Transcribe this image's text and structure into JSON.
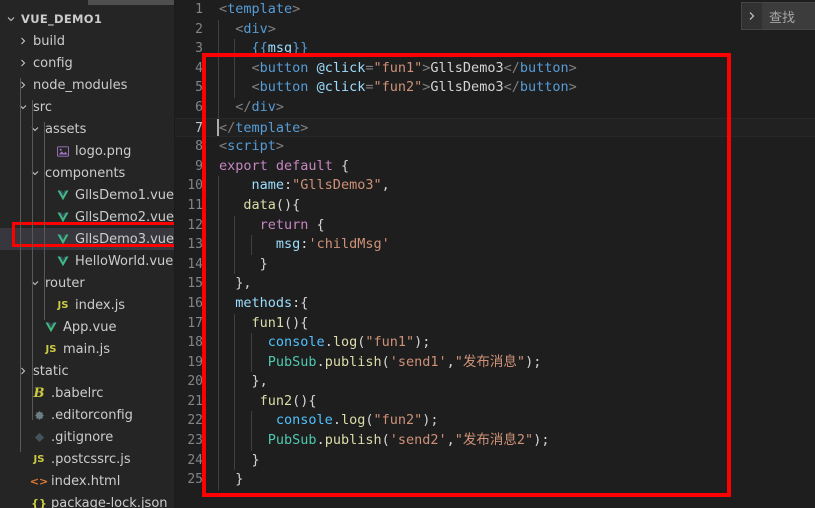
{
  "window": {
    "theme_bg": "#1e1e1e",
    "sidebar_bg": "#252526",
    "accent_red": "#ff0000"
  },
  "sidebar": {
    "root_label": "VUE_DEMO1",
    "items": [
      {
        "label": "build",
        "indent": 1,
        "type": "folder",
        "expanded": false
      },
      {
        "label": "config",
        "indent": 1,
        "type": "folder",
        "expanded": false
      },
      {
        "label": "node_modules",
        "indent": 1,
        "type": "folder",
        "expanded": false
      },
      {
        "label": "src",
        "indent": 1,
        "type": "folder",
        "expanded": true
      },
      {
        "label": "assets",
        "indent": 2,
        "type": "folder",
        "expanded": true
      },
      {
        "label": "logo.png",
        "indent": 3,
        "type": "image"
      },
      {
        "label": "components",
        "indent": 2,
        "type": "folder",
        "expanded": true
      },
      {
        "label": "GllsDemo1.vue",
        "indent": 3,
        "type": "vue"
      },
      {
        "label": "GllsDemo2.vue",
        "indent": 3,
        "type": "vue"
      },
      {
        "label": "GllsDemo3.vue",
        "indent": 3,
        "type": "vue",
        "selected": true,
        "highlighted": true
      },
      {
        "label": "HelloWorld.vue",
        "indent": 3,
        "type": "vue"
      },
      {
        "label": "router",
        "indent": 2,
        "type": "folder",
        "expanded": true
      },
      {
        "label": "index.js",
        "indent": 3,
        "type": "js"
      },
      {
        "label": "App.vue",
        "indent": 2,
        "type": "vue"
      },
      {
        "label": "main.js",
        "indent": 2,
        "type": "js"
      },
      {
        "label": "static",
        "indent": 1,
        "type": "folder",
        "expanded": false
      },
      {
        "label": ".babelrc",
        "indent": 1,
        "type": "babel"
      },
      {
        "label": ".editorconfig",
        "indent": 1,
        "type": "gear"
      },
      {
        "label": ".gitignore",
        "indent": 1,
        "type": "git"
      },
      {
        "label": ".postcssrc.js",
        "indent": 1,
        "type": "js"
      },
      {
        "label": "index.html",
        "indent": 1,
        "type": "html"
      },
      {
        "label": "package-lock.json",
        "indent": 1,
        "type": "json"
      }
    ]
  },
  "find_widget": {
    "toggle_icon": "chevron-right-icon",
    "placeholder": "查找",
    "value": ""
  },
  "editor": {
    "active_line": 7,
    "first_line": 1,
    "last_line": 25,
    "lines": [
      {
        "n": 1,
        "tokens": [
          [
            "t-brk",
            "<"
          ],
          [
            "t-tag",
            "template"
          ],
          [
            "t-brk",
            ">"
          ]
        ],
        "indent": 0
      },
      {
        "n": 2,
        "tokens": [
          [
            "t-txt",
            "  "
          ],
          [
            "t-brk",
            "<"
          ],
          [
            "t-tag",
            "div"
          ],
          [
            "t-brk",
            ">"
          ]
        ],
        "indent": 1
      },
      {
        "n": 3,
        "tokens": [
          [
            "t-txt",
            "    "
          ],
          [
            "t-mustache",
            "{{"
          ],
          [
            "t-attr",
            "msg"
          ],
          [
            "t-mustache",
            "}}"
          ]
        ],
        "indent": 2
      },
      {
        "n": 4,
        "tokens": [
          [
            "t-txt",
            "    "
          ],
          [
            "t-brk",
            "<"
          ],
          [
            "t-tag",
            "button"
          ],
          [
            "t-txt",
            " "
          ],
          [
            "t-attr",
            "@click"
          ],
          [
            "t-brk",
            "="
          ],
          [
            "t-str",
            "\"fun1\""
          ],
          [
            "t-brk",
            ">"
          ],
          [
            "t-txt",
            "GllsDemo3"
          ],
          [
            "t-brk",
            "</"
          ],
          [
            "t-tag",
            "button"
          ],
          [
            "t-brk",
            ">"
          ]
        ],
        "indent": 2
      },
      {
        "n": 5,
        "tokens": [
          [
            "t-txt",
            "    "
          ],
          [
            "t-brk",
            "<"
          ],
          [
            "t-tag",
            "button"
          ],
          [
            "t-txt",
            " "
          ],
          [
            "t-attr",
            "@click"
          ],
          [
            "t-brk",
            "="
          ],
          [
            "t-str",
            "\"fun2\""
          ],
          [
            "t-brk",
            ">"
          ],
          [
            "t-txt",
            "GllsDemo3"
          ],
          [
            "t-brk",
            "</"
          ],
          [
            "t-tag",
            "button"
          ],
          [
            "t-brk",
            ">"
          ]
        ],
        "indent": 2
      },
      {
        "n": 6,
        "tokens": [
          [
            "t-txt",
            "  "
          ],
          [
            "t-brk",
            "</"
          ],
          [
            "t-tag",
            "div"
          ],
          [
            "t-brk",
            ">"
          ]
        ],
        "indent": 1
      },
      {
        "n": 7,
        "tokens": [
          [
            "t-brk",
            "</"
          ],
          [
            "t-tag",
            "template"
          ],
          [
            "t-brk",
            ">"
          ]
        ],
        "indent": 0
      },
      {
        "n": 8,
        "tokens": [
          [
            "t-brk",
            "<"
          ],
          [
            "t-tag",
            "script"
          ],
          [
            "t-brk",
            ">"
          ]
        ],
        "indent": 0
      },
      {
        "n": 9,
        "tokens": [
          [
            "t-kw",
            "export"
          ],
          [
            "t-txt",
            " "
          ],
          [
            "t-kw",
            "default"
          ],
          [
            "t-txt",
            " {"
          ]
        ],
        "indent": 0
      },
      {
        "n": 10,
        "tokens": [
          [
            "t-txt",
            "    "
          ],
          [
            "t-prop",
            "name"
          ],
          [
            "t-txt",
            ":"
          ],
          [
            "t-str",
            "\"GllsDemo3\""
          ],
          [
            "t-txt",
            ","
          ]
        ],
        "indent": 1
      },
      {
        "n": 11,
        "tokens": [
          [
            "t-txt",
            "   "
          ],
          [
            "t-fn",
            "data"
          ],
          [
            "t-txt",
            "(){"
          ]
        ],
        "indent": 1
      },
      {
        "n": 12,
        "tokens": [
          [
            "t-txt",
            "     "
          ],
          [
            "t-kw",
            "return"
          ],
          [
            "t-txt",
            " {"
          ]
        ],
        "indent": 2
      },
      {
        "n": 13,
        "tokens": [
          [
            "t-txt",
            "       "
          ],
          [
            "t-prop",
            "msg"
          ],
          [
            "t-txt",
            ":"
          ],
          [
            "t-str",
            "'childMsg'"
          ]
        ],
        "indent": 3
      },
      {
        "n": 14,
        "tokens": [
          [
            "t-txt",
            "     }"
          ]
        ],
        "indent": 2
      },
      {
        "n": 15,
        "tokens": [
          [
            "t-txt",
            "  },"
          ]
        ],
        "indent": 1
      },
      {
        "n": 16,
        "tokens": [
          [
            "t-txt",
            "  "
          ],
          [
            "t-prop",
            "methods"
          ],
          [
            "t-txt",
            ":{"
          ]
        ],
        "indent": 1
      },
      {
        "n": 17,
        "tokens": [
          [
            "t-txt",
            "    "
          ],
          [
            "t-fn",
            "fun1"
          ],
          [
            "t-txt",
            "(){"
          ]
        ],
        "indent": 2
      },
      {
        "n": 18,
        "tokens": [
          [
            "t-txt",
            "      "
          ],
          [
            "t-var",
            "console"
          ],
          [
            "t-txt",
            "."
          ],
          [
            "t-fn",
            "log"
          ],
          [
            "t-txt",
            "("
          ],
          [
            "t-str",
            "\"fun1\""
          ],
          [
            "t-txt",
            ");"
          ]
        ],
        "indent": 3
      },
      {
        "n": 19,
        "tokens": [
          [
            "t-txt",
            "      "
          ],
          [
            "t-obj",
            "PubSub"
          ],
          [
            "t-txt",
            "."
          ],
          [
            "t-fn",
            "publish"
          ],
          [
            "t-txt",
            "("
          ],
          [
            "t-str",
            "'send1'"
          ],
          [
            "t-txt",
            ","
          ],
          [
            "t-str",
            "\"发布消息\""
          ],
          [
            "t-txt",
            ");"
          ]
        ],
        "indent": 3
      },
      {
        "n": 20,
        "tokens": [
          [
            "t-txt",
            "    },"
          ]
        ],
        "indent": 2
      },
      {
        "n": 21,
        "tokens": [
          [
            "t-txt",
            "     "
          ],
          [
            "t-fn",
            "fun2"
          ],
          [
            "t-txt",
            "(){"
          ]
        ],
        "indent": 2
      },
      {
        "n": 22,
        "tokens": [
          [
            "t-txt",
            "       "
          ],
          [
            "t-var",
            "console"
          ],
          [
            "t-txt",
            "."
          ],
          [
            "t-fn",
            "log"
          ],
          [
            "t-txt",
            "("
          ],
          [
            "t-str",
            "\"fun2\""
          ],
          [
            "t-txt",
            ");"
          ]
        ],
        "indent": 3
      },
      {
        "n": 23,
        "tokens": [
          [
            "t-txt",
            "      "
          ],
          [
            "t-obj",
            "PubSub"
          ],
          [
            "t-txt",
            "."
          ],
          [
            "t-fn",
            "publish"
          ],
          [
            "t-txt",
            "("
          ],
          [
            "t-str",
            "'send2'"
          ],
          [
            "t-txt",
            ","
          ],
          [
            "t-str",
            "\"发布消息2\""
          ],
          [
            "t-txt",
            ");"
          ]
        ],
        "indent": 3
      },
      {
        "n": 24,
        "tokens": [
          [
            "t-txt",
            "    }"
          ]
        ],
        "indent": 2
      },
      {
        "n": 25,
        "tokens": [
          [
            "t-txt",
            "  }"
          ]
        ],
        "indent": 1
      }
    ]
  }
}
